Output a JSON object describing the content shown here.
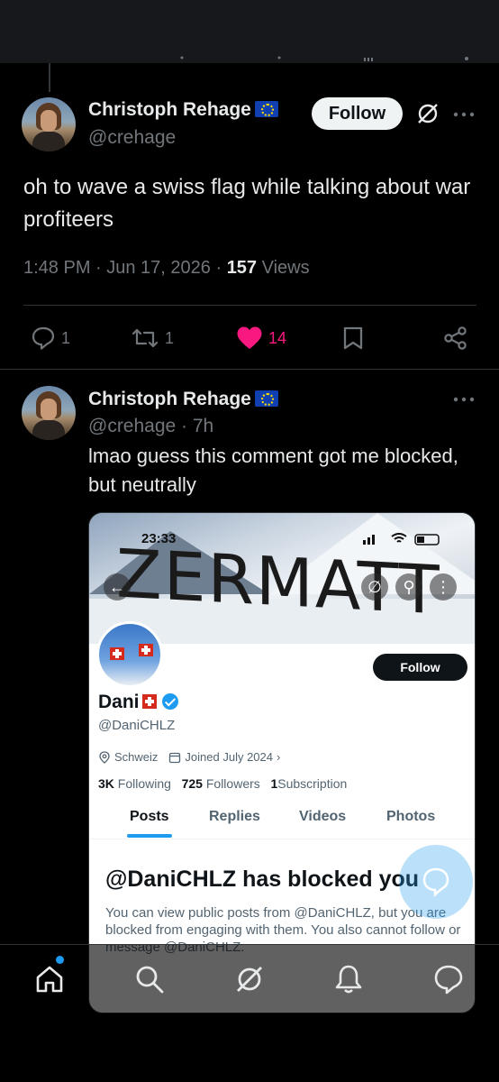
{
  "thread": {
    "main_post": {
      "author_name": "Christoph Rehage",
      "author_handle": "@crehage",
      "follow_label": "Follow",
      "text": "oh to wave a swiss flag while talking about war profiteers",
      "time": "1:48 PM · Jun 17, 2026 · ",
      "views_count": "157",
      "views_label": " Views",
      "replies": "1",
      "reposts": "1",
      "likes": "14"
    },
    "reply": {
      "author_name": "Christoph Rehage",
      "author_handle": "@crehage · 7h",
      "text": "lmao guess this comment got me blocked, but neutrally"
    }
  },
  "embed": {
    "status_time": "23:33",
    "banner_text": "ZERMATT",
    "follow_label": "Follow",
    "profile_name": "Dani",
    "profile_handle": "@DaniCHLZ",
    "location": "Schweiz",
    "joined": "Joined July 2024",
    "following_count": "3K",
    "following_label": "Following",
    "followers_count": "725",
    "followers_label": "Followers",
    "subscription_count": "1",
    "subscription_label": "Subscription",
    "tabs": [
      "Posts",
      "Replies",
      "Videos",
      "Photos"
    ],
    "blocked_title": "@DaniCHLZ has blocked you",
    "blocked_body": "You can view public posts from @DaniCHLZ, but you are blocked from engaging with them. You also cannot follow or message @DaniCHLZ."
  },
  "colors": {
    "background": "#000000",
    "text": "#e7e9ea",
    "secondary": "#71767b",
    "like": "#f91880",
    "accent": "#1d9bf0"
  },
  "icons": [
    "grok-icon",
    "more-icon",
    "reply-icon",
    "repost-icon",
    "heart-icon",
    "bookmark-icon",
    "share-icon",
    "home-icon",
    "search-icon",
    "grok-nav-icon",
    "notifications-icon",
    "messages-icon"
  ]
}
